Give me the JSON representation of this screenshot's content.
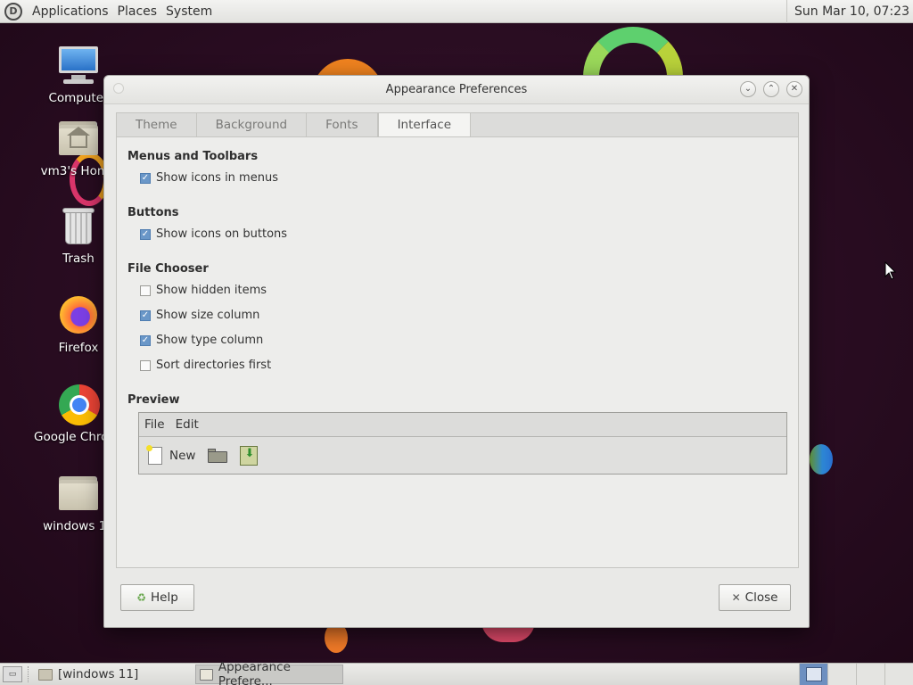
{
  "top_panel": {
    "menus": [
      "Applications",
      "Places",
      "System"
    ],
    "clock": "Sun Mar 10, 07:23",
    "logo_icon": "distro-logo-icon"
  },
  "desktop_icons": [
    {
      "label": "Computer",
      "icon": "computer-icon"
    },
    {
      "label": "vm3's Home",
      "icon": "home-folder-icon"
    },
    {
      "label": "Trash",
      "icon": "trash-icon"
    },
    {
      "label": "Firefox",
      "icon": "firefox-icon"
    },
    {
      "label": "Google Chrome",
      "icon": "chrome-icon"
    },
    {
      "label": "windows 11",
      "icon": "folder-icon"
    }
  ],
  "dialog": {
    "title": "Appearance Preferences",
    "tabs": [
      {
        "label": "Theme",
        "active": false
      },
      {
        "label": "Background",
        "active": false
      },
      {
        "label": "Fonts",
        "active": false
      },
      {
        "label": "Interface",
        "active": true
      }
    ],
    "sections": {
      "menus_toolbars": {
        "title": "Menus and Toolbars",
        "options": [
          {
            "label": "Show icons in menus",
            "checked": true
          }
        ]
      },
      "buttons": {
        "title": "Buttons",
        "options": [
          {
            "label": "Show icons on buttons",
            "checked": true
          }
        ]
      },
      "file_chooser": {
        "title": "File Chooser",
        "options": [
          {
            "label": "Show hidden items",
            "checked": false
          },
          {
            "label": "Show size column",
            "checked": true
          },
          {
            "label": "Show type column",
            "checked": true
          },
          {
            "label": "Sort directories first",
            "checked": false
          }
        ]
      },
      "preview": {
        "title": "Preview",
        "menus": [
          "File",
          "Edit"
        ],
        "toolbar_new": "New"
      }
    },
    "buttons": {
      "help": "Help",
      "close": "Close"
    }
  },
  "taskbar": {
    "items": [
      {
        "label": "[windows 11]",
        "active": false
      },
      {
        "label": "Appearance Prefere...",
        "active": true
      }
    ],
    "workspaces": 4,
    "current_workspace": 1
  }
}
